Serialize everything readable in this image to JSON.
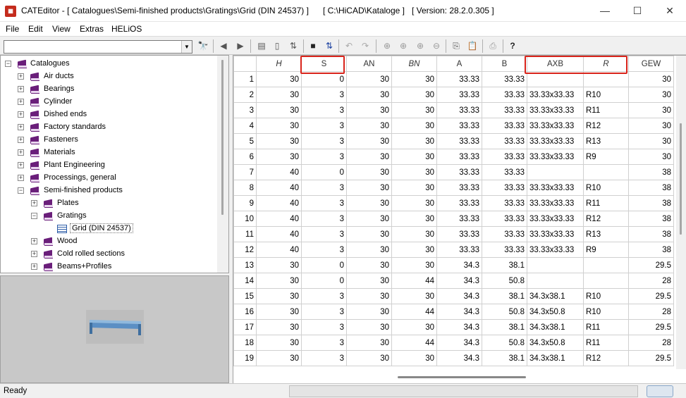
{
  "window": {
    "title": "CATEditor - [ Catalogues\\Semi-finished products\\Gratings\\Grid (DIN 24537) ]      [ C:\\HiCAD\\Kataloge ]   [ Version: 28.2.0.305 ]",
    "minimize": "—",
    "maximize": "☐",
    "close": "✕"
  },
  "menu": [
    "File",
    "Edit",
    "View",
    "Extras",
    "HELiOS"
  ],
  "toolbar": {
    "combo_value": "",
    "buttons": [
      "binoculars-icon",
      "back-icon",
      "forward-icon",
      "copy-doc-icon",
      "new-doc-icon",
      "sort-icon",
      "save-icon",
      "sort-updown-icon",
      "undo-icon",
      "redo-icon",
      "add-col-left-icon",
      "add-col-icon",
      "add-row-icon",
      "del-row-icon",
      "copy-icon",
      "paste-icon",
      "print-icon",
      "help-icon"
    ]
  },
  "tree": {
    "root": "Catalogues",
    "items": [
      {
        "label": "Air ducts"
      },
      {
        "label": "Bearings"
      },
      {
        "label": "Cylinder"
      },
      {
        "label": "Dished ends"
      },
      {
        "label": "Factory standards"
      },
      {
        "label": "Fasteners"
      },
      {
        "label": "Materials"
      },
      {
        "label": "Plant Engineering"
      },
      {
        "label": "Processings, general"
      },
      {
        "label": "Semi-finished products"
      },
      {
        "label": "Plates"
      },
      {
        "label": "Gratings"
      },
      {
        "label": "Grid (DIN 24537)"
      },
      {
        "label": "Wood"
      },
      {
        "label": "Cold rolled sections"
      },
      {
        "label": "Beams+Profiles"
      }
    ]
  },
  "grid": {
    "columns": [
      "H",
      "S",
      "AN",
      "BN",
      "A",
      "B",
      "AXB",
      "R",
      "GEW"
    ],
    "italic_columns": [
      0,
      3,
      7
    ],
    "highlighted_columns": [
      "S",
      "AXB",
      "R"
    ],
    "rows": [
      [
        "1",
        "30",
        "0",
        "30",
        "30",
        "33.33",
        "33.33",
        "",
        "",
        "30"
      ],
      [
        "2",
        "30",
        "3",
        "30",
        "30",
        "33.33",
        "33.33",
        "33.33x33.33",
        "R10",
        "30"
      ],
      [
        "3",
        "30",
        "3",
        "30",
        "30",
        "33.33",
        "33.33",
        "33.33x33.33",
        "R11",
        "30"
      ],
      [
        "4",
        "30",
        "3",
        "30",
        "30",
        "33.33",
        "33.33",
        "33.33x33.33",
        "R12",
        "30"
      ],
      [
        "5",
        "30",
        "3",
        "30",
        "30",
        "33.33",
        "33.33",
        "33.33x33.33",
        "R13",
        "30"
      ],
      [
        "6",
        "30",
        "3",
        "30",
        "30",
        "33.33",
        "33.33",
        "33.33x33.33",
        "R9",
        "30"
      ],
      [
        "7",
        "40",
        "0",
        "30",
        "30",
        "33.33",
        "33.33",
        "",
        "",
        "38"
      ],
      [
        "8",
        "40",
        "3",
        "30",
        "30",
        "33.33",
        "33.33",
        "33.33x33.33",
        "R10",
        "38"
      ],
      [
        "9",
        "40",
        "3",
        "30",
        "30",
        "33.33",
        "33.33",
        "33.33x33.33",
        "R11",
        "38"
      ],
      [
        "10",
        "40",
        "3",
        "30",
        "30",
        "33.33",
        "33.33",
        "33.33x33.33",
        "R12",
        "38"
      ],
      [
        "11",
        "40",
        "3",
        "30",
        "30",
        "33.33",
        "33.33",
        "33.33x33.33",
        "R13",
        "38"
      ],
      [
        "12",
        "40",
        "3",
        "30",
        "30",
        "33.33",
        "33.33",
        "33.33x33.33",
        "R9",
        "38"
      ],
      [
        "13",
        "30",
        "0",
        "30",
        "30",
        "34.3",
        "38.1",
        "",
        "",
        "29.5"
      ],
      [
        "14",
        "30",
        "0",
        "30",
        "44",
        "34.3",
        "50.8",
        "",
        "",
        "28"
      ],
      [
        "15",
        "30",
        "3",
        "30",
        "30",
        "34.3",
        "38.1",
        "34.3x38.1",
        "R10",
        "29.5"
      ],
      [
        "16",
        "30",
        "3",
        "30",
        "44",
        "34.3",
        "50.8",
        "34.3x50.8",
        "R10",
        "28"
      ],
      [
        "17",
        "30",
        "3",
        "30",
        "30",
        "34.3",
        "38.1",
        "34.3x38.1",
        "R11",
        "29.5"
      ],
      [
        "18",
        "30",
        "3",
        "30",
        "44",
        "34.3",
        "50.8",
        "34.3x50.8",
        "R11",
        "28"
      ],
      [
        "19",
        "30",
        "3",
        "30",
        "30",
        "34.3",
        "38.1",
        "34.3x38.1",
        "R12",
        "29.5"
      ]
    ]
  },
  "status": {
    "text": "Ready"
  },
  "colors": {
    "highlight": "#d9241b",
    "book": "#6a1e7a"
  }
}
